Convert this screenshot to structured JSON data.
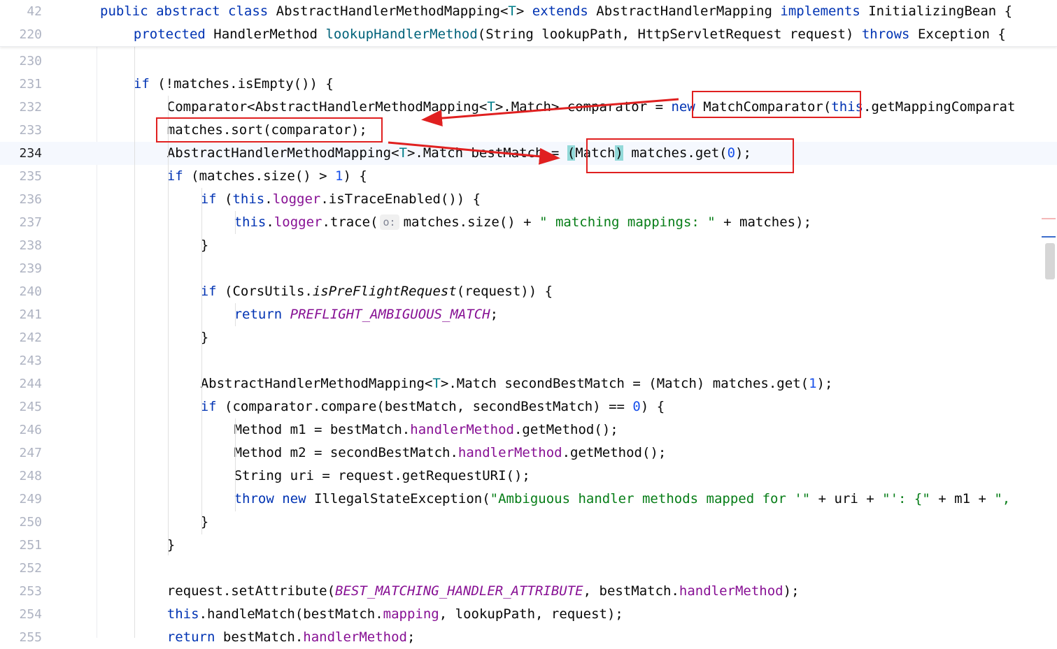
{
  "sticky_lines": [
    {
      "num": "42",
      "indent": 0,
      "tokens": [
        [
          "kw",
          "public abstract class "
        ],
        [
          "",
          "AbstractHandlerMethodMapping<"
        ],
        [
          "tp",
          "T"
        ],
        [
          "",
          "> "
        ],
        [
          "kw",
          "extends "
        ],
        [
          "",
          "AbstractHandlerMapping "
        ],
        [
          "kw",
          "implements "
        ],
        [
          "",
          "InitializingBean {"
        ]
      ]
    },
    {
      "num": "220",
      "indent": 1,
      "tokens": [
        [
          "kw",
          "protected "
        ],
        [
          "",
          "HandlerMethod "
        ],
        [
          "fn",
          "lookupHandlerMethod"
        ],
        [
          "",
          "(String lookupPath, HttpServletRequest request) "
        ],
        [
          "kw",
          "throws "
        ],
        [
          "",
          "Exception {"
        ]
      ]
    }
  ],
  "lines": [
    {
      "num": "230",
      "indent": 0,
      "tokens": []
    },
    {
      "num": "231",
      "indent": 1,
      "tokens": [
        [
          "kw",
          "if "
        ],
        [
          "",
          "(!matches.isEmpty()) {"
        ]
      ]
    },
    {
      "num": "232",
      "indent": 2,
      "tokens": [
        [
          "",
          "Comparator<AbstractHandlerMethodMapping<"
        ],
        [
          "tp",
          "T"
        ],
        [
          "",
          ">.Match> comparator = "
        ],
        [
          "kw",
          "new "
        ],
        [
          "",
          "MatchComparator("
        ],
        [
          "kw",
          "this"
        ],
        [
          "",
          ".getMappingComparat"
        ]
      ]
    },
    {
      "num": "233",
      "indent": 2,
      "tokens": [
        [
          "",
          "matches.sort(comparator);"
        ]
      ]
    },
    {
      "num": "234",
      "indent": 2,
      "current": true,
      "tokens": [
        [
          "",
          "AbstractHandlerMethodMapping<"
        ],
        [
          "tp",
          "T"
        ],
        [
          "",
          ">.Match bestMatch = "
        ],
        [
          "hl",
          "("
        ],
        [
          "",
          "Match"
        ],
        [
          "hl",
          ")"
        ],
        [
          "",
          " matches.get("
        ],
        [
          "num",
          "0"
        ],
        [
          "",
          ");"
        ]
      ]
    },
    {
      "num": "235",
      "indent": 2,
      "tokens": [
        [
          "kw",
          "if "
        ],
        [
          "",
          "(matches.size() > "
        ],
        [
          "num",
          "1"
        ],
        [
          "",
          ") {"
        ]
      ]
    },
    {
      "num": "236",
      "indent": 3,
      "tokens": [
        [
          "kw",
          "if "
        ],
        [
          "",
          "("
        ],
        [
          "kw",
          "this"
        ],
        [
          "",
          "."
        ],
        [
          "fld",
          "logger"
        ],
        [
          "",
          ".isTraceEnabled()) {"
        ]
      ]
    },
    {
      "num": "237",
      "indent": 4,
      "tokens": [
        [
          "kw",
          "this"
        ],
        [
          "",
          "."
        ],
        [
          "fld",
          "logger"
        ],
        [
          "",
          ".trace("
        ],
        [
          "hint",
          "o:"
        ],
        [
          "",
          "matches.size() + "
        ],
        [
          "str",
          "\" matching mappings: \""
        ],
        [
          "",
          " + matches);"
        ]
      ]
    },
    {
      "num": "238",
      "indent": 3,
      "tokens": [
        [
          "",
          "}"
        ]
      ]
    },
    {
      "num": "239",
      "indent": 0,
      "tokens": []
    },
    {
      "num": "240",
      "indent": 3,
      "tokens": [
        [
          "kw",
          "if "
        ],
        [
          "",
          "(CorsUtils."
        ],
        [
          "it",
          "isPreFlightRequest"
        ],
        [
          "",
          "(request)) {"
        ]
      ]
    },
    {
      "num": "241",
      "indent": 4,
      "tokens": [
        [
          "kw",
          "return "
        ],
        [
          "cst",
          "PREFLIGHT_AMBIGUOUS_MATCH"
        ],
        [
          "",
          ";"
        ]
      ]
    },
    {
      "num": "242",
      "indent": 3,
      "tokens": [
        [
          "",
          "}"
        ]
      ]
    },
    {
      "num": "243",
      "indent": 0,
      "tokens": []
    },
    {
      "num": "244",
      "indent": 3,
      "tokens": [
        [
          "",
          "AbstractHandlerMethodMapping<"
        ],
        [
          "tp",
          "T"
        ],
        [
          "",
          ">.Match secondBestMatch = (Match) matches.get("
        ],
        [
          "num",
          "1"
        ],
        [
          "",
          ");"
        ]
      ]
    },
    {
      "num": "245",
      "indent": 3,
      "tokens": [
        [
          "kw",
          "if "
        ],
        [
          "",
          "(comparator.compare(bestMatch, secondBestMatch) == "
        ],
        [
          "num",
          "0"
        ],
        [
          "",
          ") {"
        ]
      ]
    },
    {
      "num": "246",
      "indent": 4,
      "tokens": [
        [
          "",
          "Method m1 = bestMatch."
        ],
        [
          "fld",
          "handlerMethod"
        ],
        [
          "",
          ".getMethod();"
        ]
      ]
    },
    {
      "num": "247",
      "indent": 4,
      "tokens": [
        [
          "",
          "Method m2 = secondBestMatch."
        ],
        [
          "fld",
          "handlerMethod"
        ],
        [
          "",
          ".getMethod();"
        ]
      ]
    },
    {
      "num": "248",
      "indent": 4,
      "tokens": [
        [
          "",
          "String uri = request.getRequestURI();"
        ]
      ]
    },
    {
      "num": "249",
      "indent": 4,
      "tokens": [
        [
          "kw",
          "throw new "
        ],
        [
          "",
          "IllegalStateException("
        ],
        [
          "str",
          "\"Ambiguous handler methods mapped for '\""
        ],
        [
          "",
          " + uri + "
        ],
        [
          "str",
          "\"': {\""
        ],
        [
          "",
          " + m1 + "
        ],
        [
          "str",
          "\", "
        ]
      ]
    },
    {
      "num": "250",
      "indent": 3,
      "tokens": [
        [
          "",
          "}"
        ]
      ]
    },
    {
      "num": "251",
      "indent": 2,
      "tokens": [
        [
          "",
          "}"
        ]
      ]
    },
    {
      "num": "252",
      "indent": 0,
      "tokens": []
    },
    {
      "num": "253",
      "indent": 2,
      "tokens": [
        [
          "",
          "request.setAttribute("
        ],
        [
          "cst",
          "BEST_MATCHING_HANDLER_ATTRIBUTE"
        ],
        [
          "",
          ", bestMatch."
        ],
        [
          "fld",
          "handlerMethod"
        ],
        [
          "",
          ");"
        ]
      ]
    },
    {
      "num": "254",
      "indent": 2,
      "tokens": [
        [
          "kw",
          "this"
        ],
        [
          "",
          ".handleMatch(bestMatch."
        ],
        [
          "fld",
          "mapping"
        ],
        [
          "",
          ", lookupPath, request);"
        ]
      ]
    },
    {
      "num": "255",
      "indent": 2,
      "tokens": [
        [
          "kw",
          "return "
        ],
        [
          "",
          "bestMatch."
        ],
        [
          "fld",
          "handlerMethod"
        ],
        [
          "",
          ";"
        ]
      ]
    }
  ],
  "annotation_color": "#e02020"
}
